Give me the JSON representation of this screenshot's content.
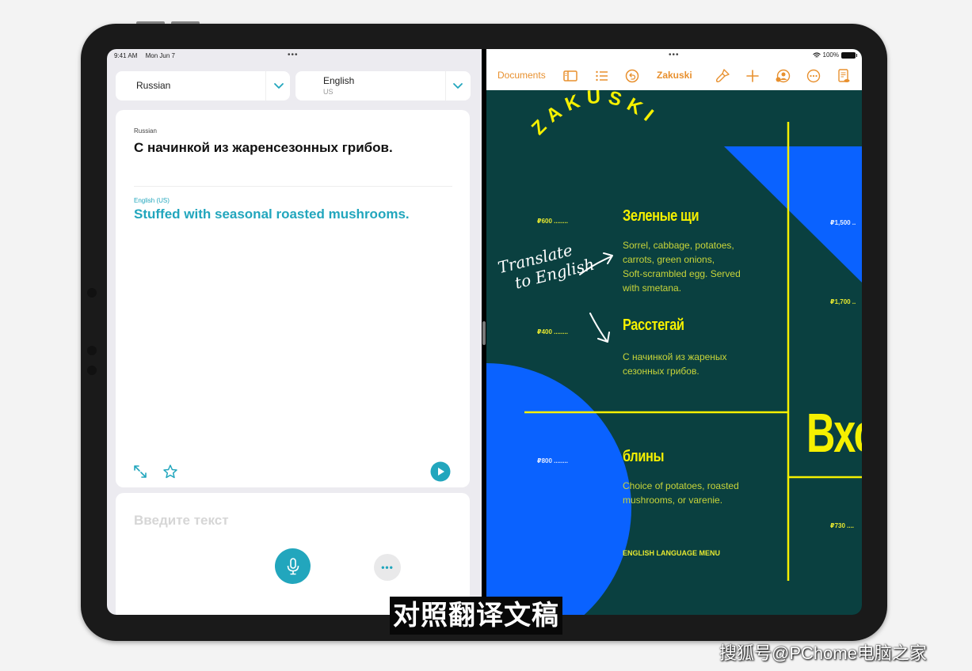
{
  "left_app": {
    "status_bar": {
      "time": "9:41 AM",
      "date": "Mon Jun 7",
      "multitask_dots": "•••"
    },
    "source_language": {
      "name": "Russian"
    },
    "target_language": {
      "name": "English",
      "region": "US"
    },
    "translation": {
      "source_label": "Russian",
      "source_text": "С начинкой из жаренсезонных грибов.",
      "target_label": "English (US)",
      "target_text": "Stuffed with seasonal roasted mushrooms."
    },
    "input": {
      "placeholder": "Введите текст",
      "more_label": "•••"
    },
    "icons": {
      "expand": "expand-icon",
      "favorite": "star-icon",
      "play": "play-icon",
      "microphone": "microphone-icon",
      "more": "more-icon"
    },
    "accent_color": "#22a6bd"
  },
  "right_app": {
    "status_bar": {
      "multitask_dots": "•••",
      "battery": "100%"
    },
    "toolbar": {
      "documents_label": "Documents",
      "document_title": "Zakuski",
      "accent_color": "#e8902e"
    },
    "menu": {
      "title": "ZAKUSKI",
      "annotation_line1": "Translate",
      "annotation_line2": "to English",
      "items": [
        {
          "price": "₽600 ........",
          "name": "Зеленые щи",
          "description": [
            "Sorrel, cabbage, potatoes,",
            "carrots, green onions,",
            "Soft-scrambled egg. Served",
            "with smetana."
          ]
        },
        {
          "price": "₽400 ........",
          "name": "Расстегай",
          "description": [
            "С начинкой из жареных",
            "сезонных грибов."
          ]
        },
        {
          "price": "₽800 ........",
          "name": "блины",
          "description": [
            "Choice of potatoes, roasted",
            "mushrooms, or varenie."
          ]
        }
      ],
      "side_prices": [
        "₽1,500 ..",
        "₽1,700 ..",
        "₽730 ...."
      ],
      "section_heading": "Вхо",
      "footer": "ENGLISH LANGUAGE MENU",
      "background_color": "#0a4040",
      "highlight_color": "#f5f000",
      "shape_color": "#0a62ff"
    }
  },
  "captions": {
    "subtitle": "对照翻译文稿",
    "watermark": "搜狐号@PChome电脑之家"
  }
}
